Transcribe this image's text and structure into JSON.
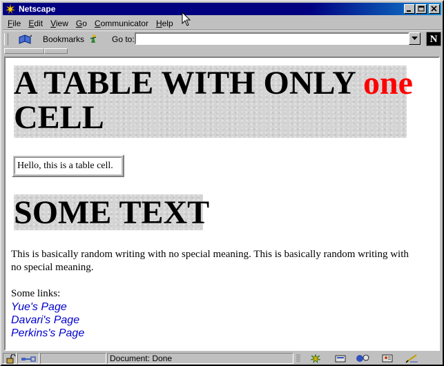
{
  "window": {
    "title": "Netscape"
  },
  "menu": {
    "items": [
      {
        "key": "F",
        "rest": "ile"
      },
      {
        "key": "E",
        "rest": "dit"
      },
      {
        "key": "V",
        "rest": "iew"
      },
      {
        "key": "G",
        "rest": "o"
      },
      {
        "key": "C",
        "rest": "ommunicator"
      },
      {
        "key": "H",
        "rest": "elp"
      }
    ]
  },
  "toolbar": {
    "bookmarks_label": "Bookmarks",
    "goto_label": "Go to:",
    "goto_value": "",
    "logo_letter": "N"
  },
  "page": {
    "heading1_black": "A TABLE WITH ONLY ",
    "heading1_red": "one",
    "heading1_end": " CELL",
    "table_cell_text": "Hello, this is a table cell.",
    "heading2": "SOME TEXT",
    "paragraph": "This is basically random writing with no special meaning. This is basically random writing with no special meaning.",
    "links_label": "Some links:",
    "links": [
      "Yue's Page",
      "Davari's Page",
      "Perkins's Page"
    ],
    "heading1_red_color": "#ff0000",
    "link_color": "#0000cc"
  },
  "status": {
    "text": "Document: Done"
  },
  "colors": {
    "titlebar": "#000080",
    "chrome": "#c0c0c0"
  }
}
